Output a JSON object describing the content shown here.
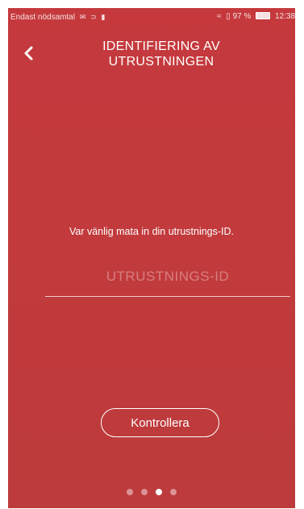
{
  "status_bar": {
    "carrier_text": "Endast nödsamtal",
    "battery_text": "97 %",
    "time": "12:38"
  },
  "header": {
    "back_icon": "chevron-left-icon",
    "title_line1": "IDENTIFIERING AV",
    "title_line2": "UTRUSTNINGEN"
  },
  "main": {
    "prompt": "Var vänlig mata in din utrustnings-ID.",
    "id_input_placeholder": "UTRUSTNINGS-ID",
    "id_input_value": ""
  },
  "actions": {
    "check_label": "Kontrollera"
  },
  "pagination": {
    "total": 4,
    "active_index": 2
  },
  "colors": {
    "background": "#c13a3c",
    "foreground": "#ffffff"
  }
}
